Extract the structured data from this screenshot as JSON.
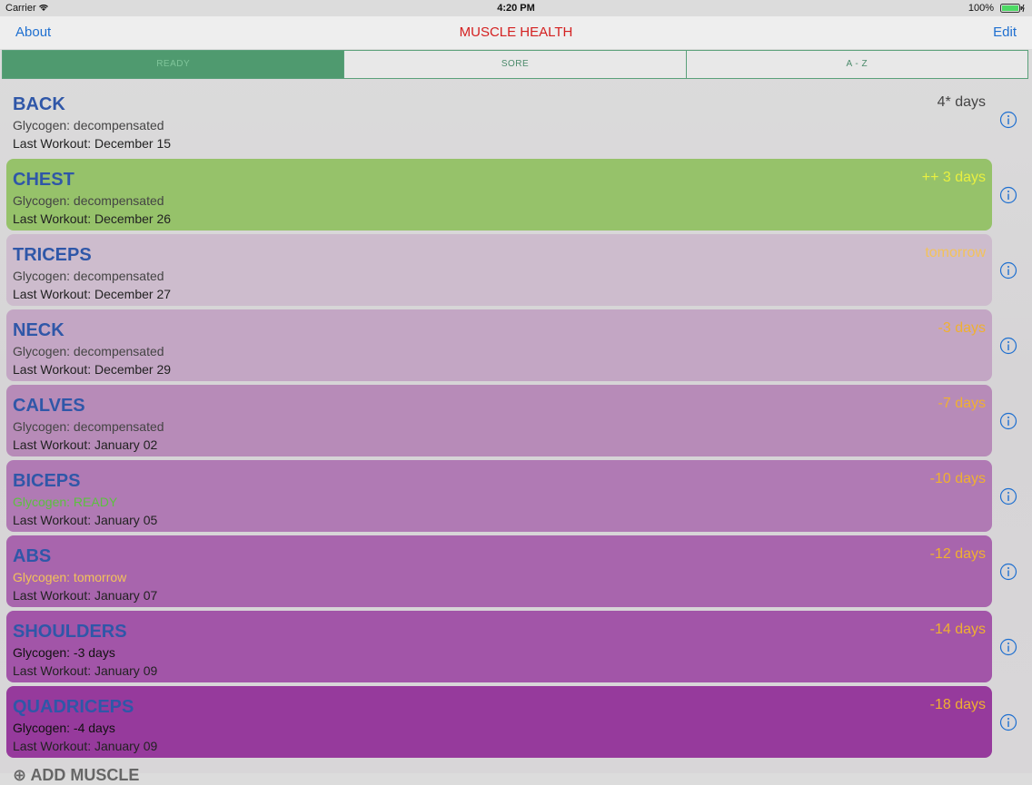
{
  "status": {
    "carrier": "Carrier",
    "time": "4:20 PM",
    "battery": "100%"
  },
  "nav": {
    "left": "About",
    "title": "MUSCLE HEALTH",
    "right": "Edit"
  },
  "segments": [
    "READY",
    "SORE",
    "A - Z"
  ],
  "rows": [
    {
      "name": "BACK",
      "glycogen": "Glycogen: decompensated",
      "last": "Last Workout: December 15",
      "days": "4* days"
    },
    {
      "name": "CHEST",
      "glycogen": "Glycogen: decompensated",
      "last": "Last Workout: December 26",
      "days": "++ 3 days"
    },
    {
      "name": "TRICEPS",
      "glycogen": "Glycogen: decompensated",
      "last": "Last Workout: December 27",
      "days": "tomorrow"
    },
    {
      "name": "NECK",
      "glycogen": "Glycogen: decompensated",
      "last": "Last Workout: December 29",
      "days": "-3 days"
    },
    {
      "name": "CALVES",
      "glycogen": "Glycogen: decompensated",
      "last": "Last Workout: January 02",
      "days": "-7 days"
    },
    {
      "name": "BICEPS",
      "glycogen": "Glycogen: READY",
      "last": "Last Workout: January 05",
      "days": "-10 days"
    },
    {
      "name": "ABS",
      "glycogen": "Glycogen: tomorrow",
      "last": "Last Workout: January 07",
      "days": "-12 days"
    },
    {
      "name": "SHOULDERS",
      "glycogen": "Glycogen: -3 days",
      "last": "Last Workout: January 09",
      "days": "-14 days"
    },
    {
      "name": "QUADRICEPS",
      "glycogen": "Glycogen: -4 days",
      "last": "Last Workout: January 09",
      "days": "-18 days"
    }
  ],
  "add_label": "ADD MUSCLE",
  "colors": {
    "accent": "#1e6fd0",
    "title": "#d42020",
    "segment_selected": "#4f9a6f",
    "ready_row": "#96c26a"
  }
}
